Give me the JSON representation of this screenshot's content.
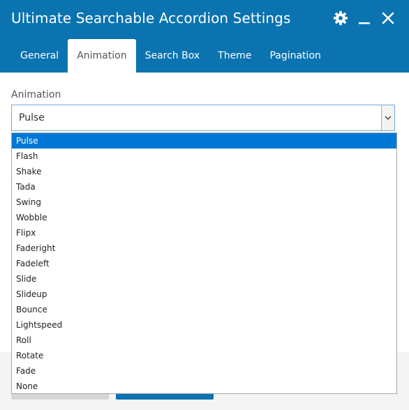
{
  "window": {
    "title": "Ultimate Searchable Accordion Settings"
  },
  "header_icons": [
    "gear-icon",
    "minimize-icon",
    "close-icon"
  ],
  "tabs": [
    {
      "label": "General"
    },
    {
      "label": "Animation",
      "active": true
    },
    {
      "label": "Search Box"
    },
    {
      "label": "Theme"
    },
    {
      "label": "Pagination"
    }
  ],
  "animation": {
    "label": "Animation",
    "selected": "Pulse",
    "options": [
      "Pulse",
      "Flash",
      "Shake",
      "Tada",
      "Swing",
      "Wobble",
      "Flipx",
      "Faderight",
      "Fadeleft",
      "Slide",
      "Slideup",
      "Bounce",
      "Lightspeed",
      "Roll",
      "Rotate",
      "Fade",
      "None"
    ]
  },
  "colors": {
    "header_bg": "#0a73b0",
    "selected_option_bg": "#0078d7",
    "select_border": "#7aa7d4"
  }
}
